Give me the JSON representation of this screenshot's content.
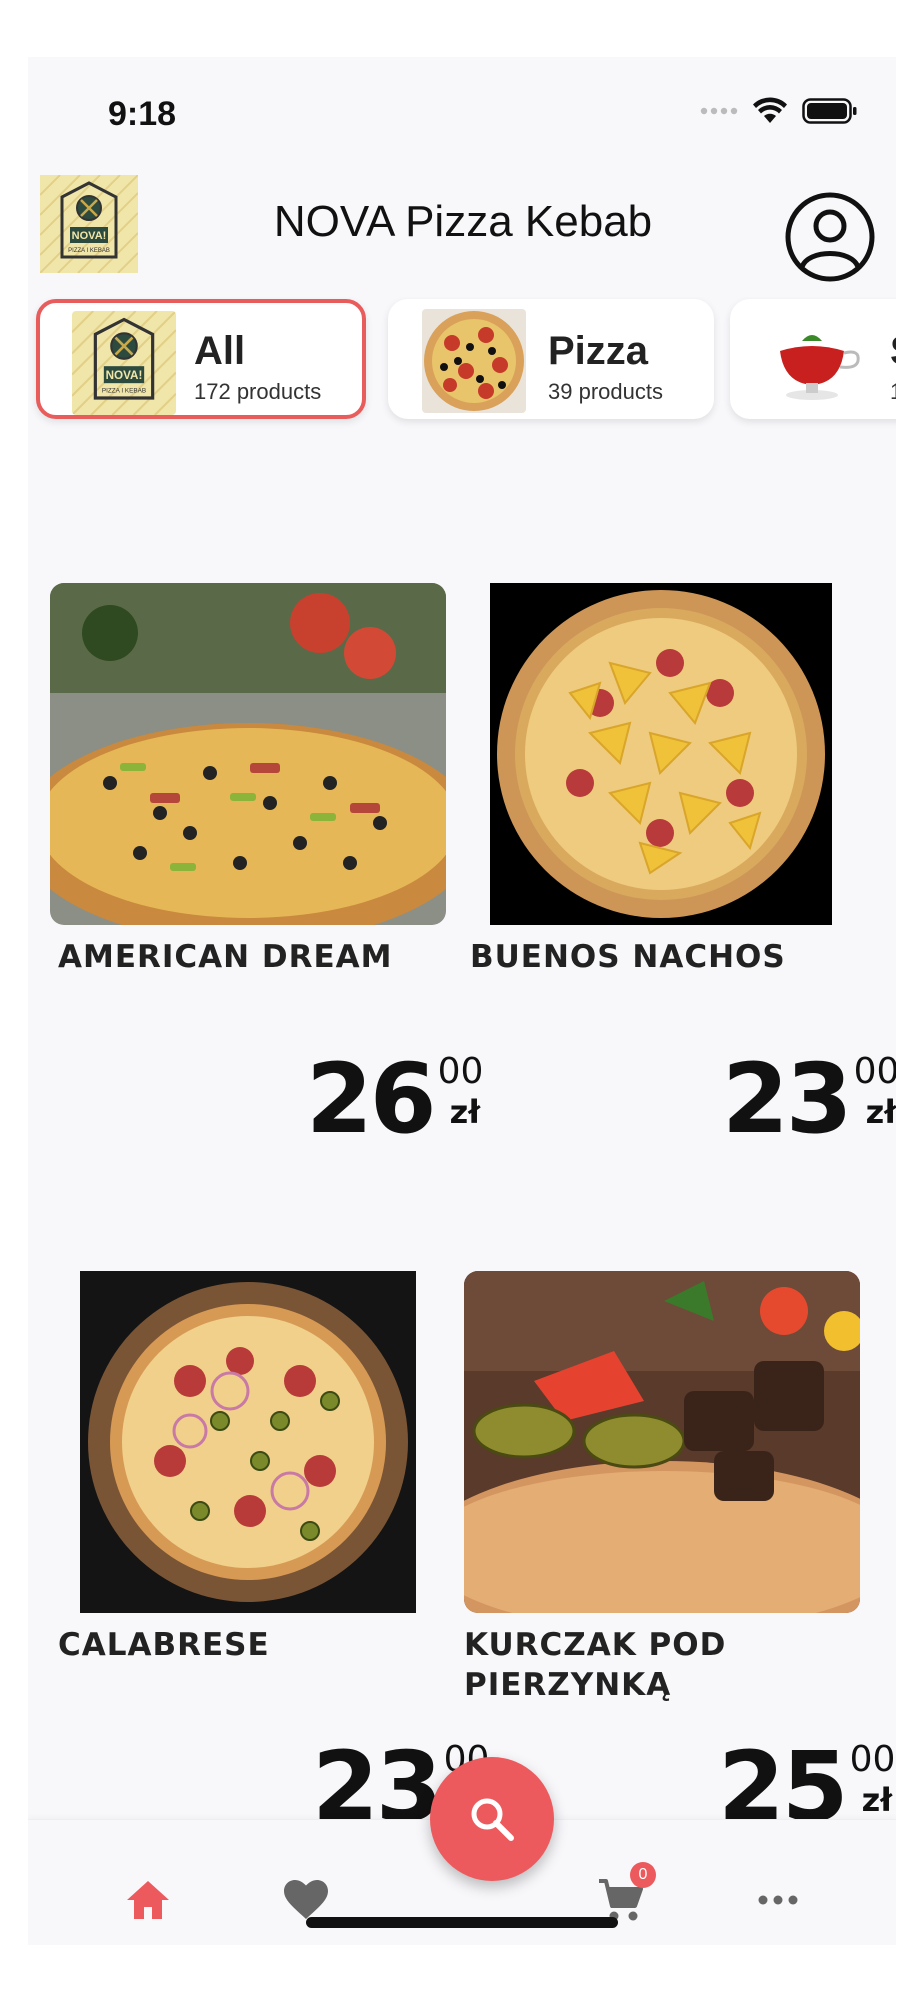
{
  "status_bar": {
    "time": "9:18"
  },
  "header": {
    "title": "NOVA Pizza Kebab",
    "logo_text": "NOVA!",
    "logo_subtext": "PIZZA I KEBAB"
  },
  "categories": [
    {
      "name": "All",
      "count": "172 products",
      "active": true
    },
    {
      "name": "Pizza",
      "count": "39 products",
      "active": false
    },
    {
      "name": "S",
      "count": "1",
      "active": false
    }
  ],
  "products": [
    {
      "name": "AMERICAN DREAM",
      "price_int": "26",
      "price_dec": "00",
      "currency": "zł"
    },
    {
      "name": "BUENOS NACHOS",
      "price_int": "23",
      "price_dec": "00",
      "currency": "zł"
    },
    {
      "name": "CALABRESE",
      "price_int": "23",
      "price_dec": "00",
      "currency": "zł"
    },
    {
      "name": "KURCZAK POD PIERZYNKĄ",
      "price_int": "25",
      "price_dec": "00",
      "currency": "zł"
    }
  ],
  "bottom_nav": {
    "items": [
      "home-icon",
      "heart-icon",
      "search-icon",
      "cart-icon",
      "more-icon"
    ],
    "cart_count": "0"
  },
  "colors": {
    "accent": "#ec5a5d",
    "background": "#f8f8fb"
  }
}
